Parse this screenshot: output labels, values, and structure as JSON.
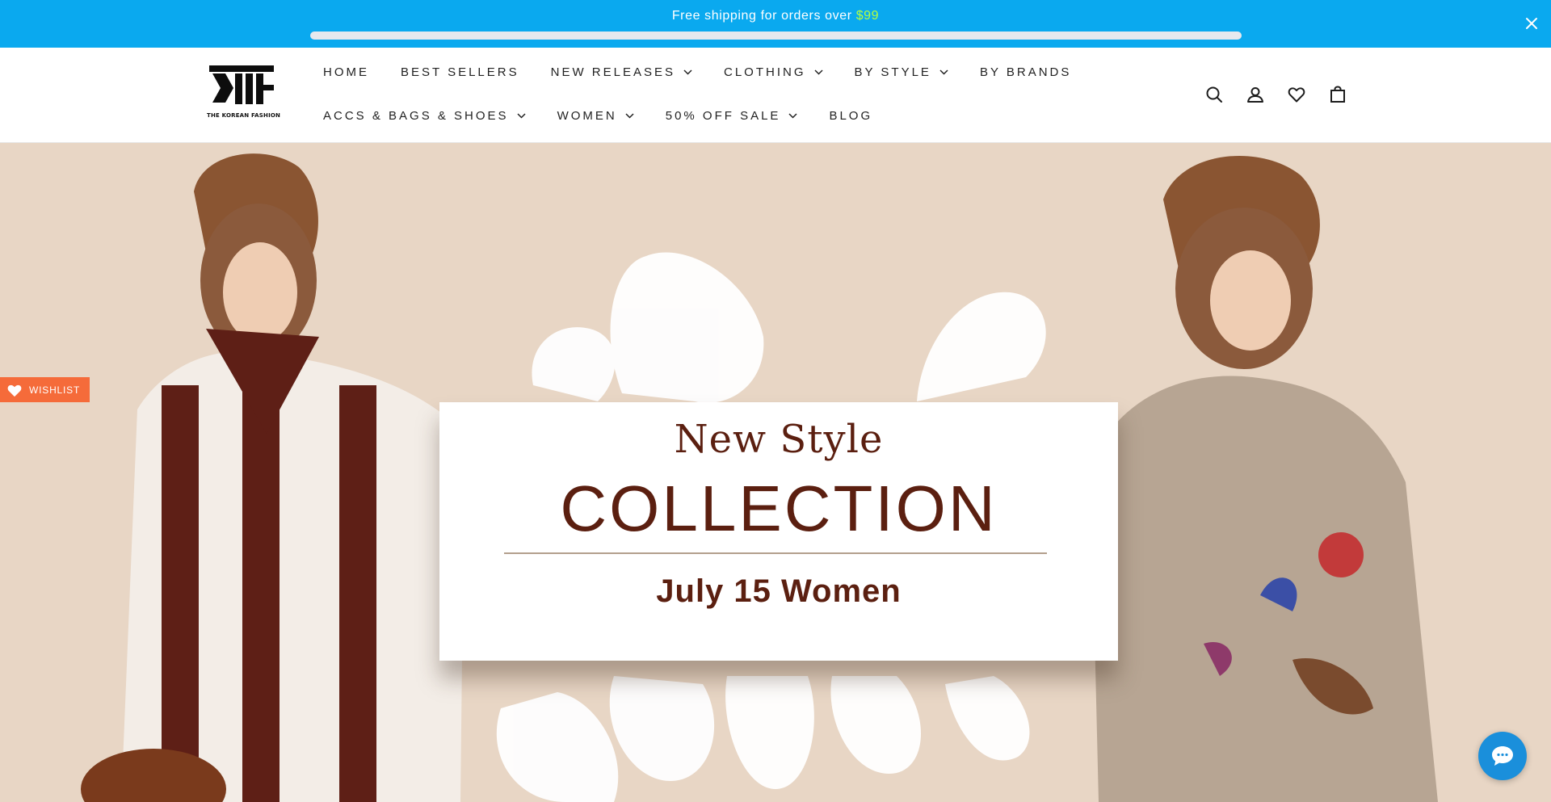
{
  "announcement": {
    "text": "Free shipping for orders over ",
    "amount": "$99",
    "amount_color": "#b6ff3d",
    "background": "#0aa9ef",
    "progress": 0
  },
  "header": {
    "logo_text": "THE KOREAN FASHION",
    "nav_row1": [
      {
        "label": "HOME",
        "has_dropdown": false
      },
      {
        "label": "BEST SELLERS",
        "has_dropdown": false
      },
      {
        "label": "NEW RELEASES",
        "has_dropdown": true
      },
      {
        "label": "CLOTHING",
        "has_dropdown": true
      },
      {
        "label": "BY STYLE",
        "has_dropdown": true
      },
      {
        "label": "BY BRANDS",
        "has_dropdown": false
      }
    ],
    "nav_row2": [
      {
        "label": "ACCS & BAGS & SHOES",
        "has_dropdown": true
      },
      {
        "label": "WOMEN",
        "has_dropdown": true
      },
      {
        "label": "50% OFF SALE",
        "has_dropdown": true
      },
      {
        "label": "BLOG",
        "has_dropdown": false
      }
    ],
    "icons": [
      "search-icon",
      "account-icon",
      "wishlist-heart-icon",
      "cart-bag-icon"
    ]
  },
  "hero": {
    "kicker": "New Style",
    "title": "COLLECTION",
    "subtitle": "July 15 Women",
    "text_color": "#5b1f10",
    "background": "#e8d6c5"
  },
  "wishlist_tab": {
    "label": "WISHLIST",
    "color": "#f56b3a"
  },
  "chat": {
    "icon": "chat-bubble-icon",
    "color": "#1a8fdb"
  }
}
